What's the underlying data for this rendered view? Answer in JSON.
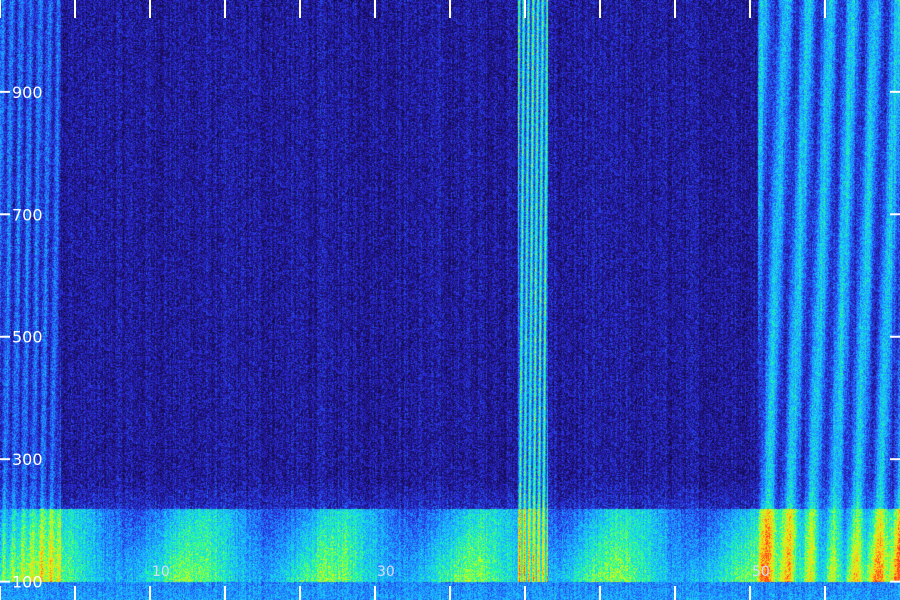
{
  "chart_data": {
    "type": "heatmap",
    "title": "",
    "xlabel": "",
    "ylabel": "",
    "colormap": [
      "#0a0520",
      "#1b0f6b",
      "#2a2ad8",
      "#1f7fff",
      "#19c8ff",
      "#1fff9a",
      "#c8ff1a",
      "#ffd21a",
      "#ff3b1a"
    ],
    "ylim": [
      70,
      1050
    ],
    "y_ticks": [
      100,
      300,
      500,
      700,
      900
    ],
    "y_tick_labels": [
      "100",
      "300",
      "500",
      "700",
      "900"
    ],
    "x_ticks": [
      0,
      5,
      10,
      15,
      20,
      25,
      30,
      35,
      40,
      45,
      50,
      55
    ],
    "x_tick_labels": [
      "",
      "",
      "10",
      "",
      "",
      "30",
      "",
      "",
      "",
      "",
      "50",
      ""
    ],
    "xlim": [
      0,
      60
    ],
    "series": [
      {
        "x": [
          0,
          4
        ],
        "y": [
          100,
          1050
        ],
        "intensity": 0.35
      },
      {
        "x": [
          34.5,
          36.5
        ],
        "y": [
          100,
          1050
        ],
        "intensity": 0.85
      },
      {
        "x": [
          50.5,
          60
        ],
        "y": [
          100,
          1050
        ],
        "intensity": 0.6
      },
      {
        "x": [
          0,
          60
        ],
        "y": [
          100,
          220
        ],
        "intensity": 0.55
      }
    ]
  }
}
